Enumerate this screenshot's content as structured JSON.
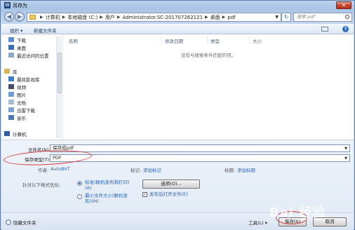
{
  "window": {
    "title": "另存为",
    "app_icon": "W"
  },
  "nav": {
    "breadcrumb": [
      "计算机",
      "本地磁盘 (C:)",
      "用户",
      "Administrator.SC-201707262121",
      "桌面",
      "pdf"
    ],
    "search_placeholder": "搜索 pdf"
  },
  "toolbar": {
    "organize": "组织 ▾",
    "new_folder": "新建文件夹"
  },
  "sidebar": {
    "items": [
      {
        "label": "下载",
        "icon": "download-folder-icon"
      },
      {
        "label": "桌面",
        "icon": "desktop-icon"
      },
      {
        "label": "最近访问的位置",
        "icon": "recent-places-icon"
      },
      {
        "label": "库",
        "icon": "libraries-icon"
      },
      {
        "label": "暴风影视库",
        "icon": "video-library-icon"
      },
      {
        "label": "视频",
        "icon": "video-icon"
      },
      {
        "label": "图片",
        "icon": "pictures-icon"
      },
      {
        "label": "文档",
        "icon": "documents-icon"
      },
      {
        "label": "迅雷下载",
        "icon": "thunder-download-icon"
      },
      {
        "label": "音乐",
        "icon": "music-icon"
      },
      {
        "label": "计算机",
        "icon": "computer-icon"
      }
    ]
  },
  "filelist": {
    "columns": [
      "名称",
      "修改日期",
      "类型",
      "大小"
    ],
    "empty_message": "没有与搜索条件匹配的项。"
  },
  "form": {
    "filename_label": "文件名(N):",
    "filename_value": "保存成pdf",
    "filetype_label": "保存类型(T):",
    "filetype_value": "PDF",
    "author_label": "作者:",
    "author_value": "AutoBVT",
    "tags_label": "标记:",
    "tags_value": "添加标记",
    "title_label": "标题:",
    "title_value": "添加标题",
    "optimize_label": "针对以下格式优化:",
    "opt_standard_line1": "标准(联机发布和打印)",
    "opt_standard_line2": "(A)",
    "opt_min_line1": "最小文件大小(联机发",
    "opt_min_line2": "布)(M)",
    "options_button": "选项(O)...",
    "open_after_label": "发布后打开文件(E)"
  },
  "footer": {
    "hide_folders": "隐藏文件夹",
    "tools": "工具(L)",
    "save": "保存(S)",
    "cancel": "取消"
  },
  "watermark": {
    "main": "Bai 经验",
    "sub": "jingyan.baidu.com"
  }
}
